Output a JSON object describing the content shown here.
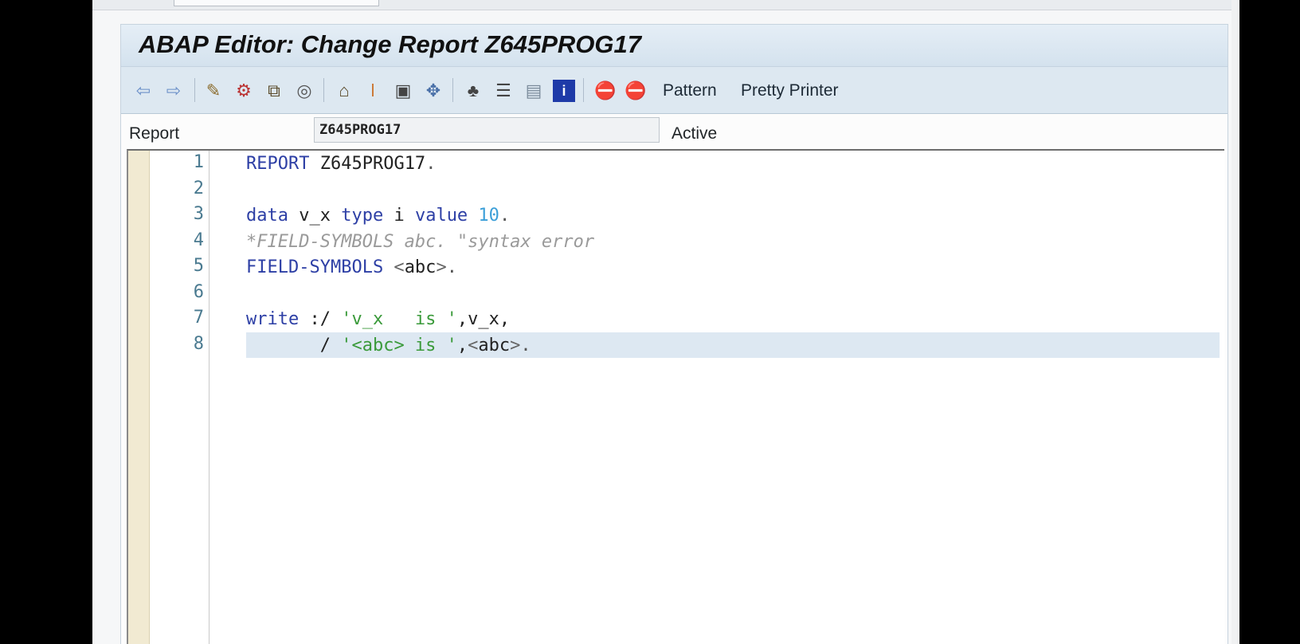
{
  "window": {
    "title": "ABAP Editor: Change Report Z645PROG17"
  },
  "toolbar": {
    "icons": [
      "back-arrow-icon",
      "forward-arrow-icon",
      "check-syntax-icon",
      "activate-icon",
      "where-used-icon",
      "object-list-icon",
      "display-object-icon",
      "breakpoint-icon",
      "display-change-icon",
      "navigation-icon",
      "hierarchy-icon",
      "layout-icon",
      "screen-icon",
      "info-icon",
      "stop-icon",
      "stop-session-icon"
    ],
    "pattern_label": "Pattern",
    "pretty_printer_label": "Pretty Printer"
  },
  "header": {
    "report_label": "Report",
    "report_value": "Z645PROG17",
    "status": "Active"
  },
  "editor": {
    "line_numbers": [
      "1",
      "2",
      "3",
      "4",
      "5",
      "6",
      "7",
      "8"
    ],
    "lines": [
      [
        {
          "t": "REPORT",
          "c": "kw"
        },
        {
          "t": " Z645PROG17",
          "c": "id"
        },
        {
          "t": ".",
          "c": "dot"
        }
      ],
      [],
      [
        {
          "t": "data",
          "c": "kw"
        },
        {
          "t": " v_x ",
          "c": "id"
        },
        {
          "t": "type",
          "c": "kw"
        },
        {
          "t": " i ",
          "c": "id"
        },
        {
          "t": "value",
          "c": "kw"
        },
        {
          "t": " 10",
          "c": "num"
        },
        {
          "t": ".",
          "c": "dot"
        }
      ],
      [
        {
          "t": "*FIELD-SYMBOLS abc. \"syntax error",
          "c": "cmt"
        }
      ],
      [
        {
          "t": "FIELD-SYMBOLS",
          "c": "kw"
        },
        {
          "t": " <",
          "c": "op"
        },
        {
          "t": "abc",
          "c": "id"
        },
        {
          "t": ">",
          "c": "op"
        },
        {
          "t": ".",
          "c": "dot"
        }
      ],
      [],
      [
        {
          "t": "write",
          "c": "kw"
        },
        {
          "t": " :/ ",
          "c": "id"
        },
        {
          "t": "'v_x   is '",
          "c": "str"
        },
        {
          "t": ",v_x,",
          "c": "id"
        }
      ],
      [
        {
          "t": "       / ",
          "c": "id"
        },
        {
          "t": "'<abc> is '",
          "c": "str"
        },
        {
          "t": ",",
          "c": "id"
        },
        {
          "t": "<",
          "c": "op"
        },
        {
          "t": "abc",
          "c": "id"
        },
        {
          "t": ">",
          "c": "op"
        },
        {
          "t": ".",
          "c": "dot"
        }
      ]
    ],
    "highlighted_line": "8"
  }
}
